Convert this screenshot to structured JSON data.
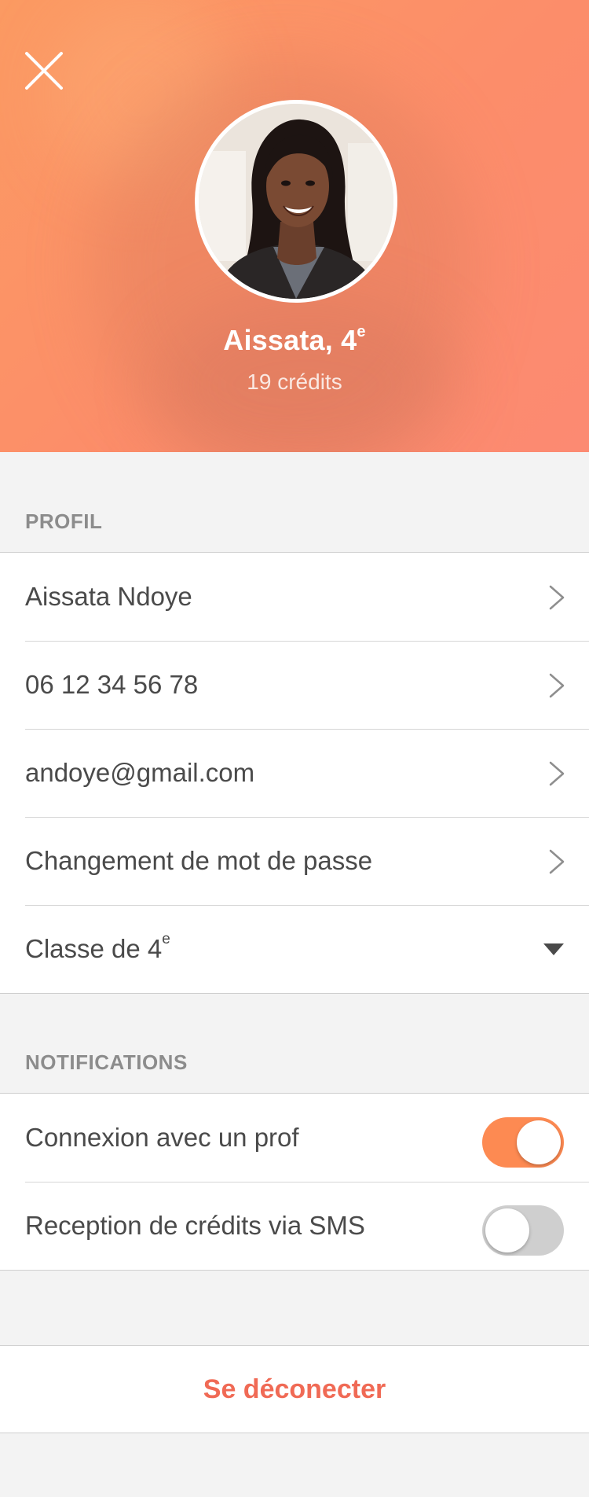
{
  "header": {
    "close_icon": "close-icon",
    "name": "Aissata, 4",
    "name_sup": "e",
    "credits": "19 crédits"
  },
  "profile_section": {
    "title": "PROFIL",
    "items": [
      {
        "label": "Aissata Ndoye",
        "icon": "chevron-right-icon"
      },
      {
        "label": "06 12 34 56 78",
        "icon": "chevron-right-icon"
      },
      {
        "label": "andoye@gmail.com",
        "icon": "chevron-right-icon"
      },
      {
        "label": "Changement de mot de passe",
        "icon": "chevron-right-icon"
      }
    ],
    "class_select": {
      "label": "Classe de 4",
      "label_sup": "e",
      "icon": "caret-down-icon"
    }
  },
  "notifications_section": {
    "title": "NOTIFICATIONS",
    "items": [
      {
        "label": "Connexion avec un prof",
        "enabled": true
      },
      {
        "label": "Reception de crédits via SMS",
        "enabled": false
      }
    ]
  },
  "logout": {
    "label": "Se déconecter"
  },
  "colors": {
    "accent": "#fd8a52",
    "logout_text": "#f06a55",
    "header_gradient_start": "#fb9a62",
    "header_gradient_end": "#fc8a72"
  }
}
